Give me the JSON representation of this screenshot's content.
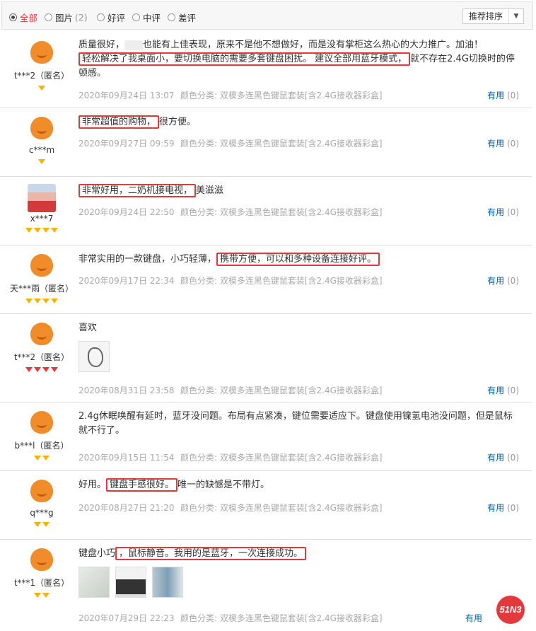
{
  "filters": [
    {
      "label": "全部",
      "checked": true
    },
    {
      "label": "图片",
      "count": "(2)",
      "checked": false
    },
    {
      "label": "好评",
      "checked": false
    },
    {
      "label": "中评",
      "checked": false
    },
    {
      "label": "差评",
      "checked": false
    }
  ],
  "sort": {
    "label": "推荐排序"
  },
  "spec_prefix": "颜色分类: ",
  "useful_label": "有用",
  "reviews": [
    {
      "user": "t***2（匿名）",
      "badge_count": 1,
      "badge_color": "#f5b400",
      "text_before": "质量很好，",
      "text_mid": "也能有上佳表现，原来不是他不想做好，而是没有掌柜这么热心的大力推广。加油！",
      "highlight": "轻松解决了我桌面小，要切换电脑的需要多套键盘困扰。 建议全部用蓝牙模式，",
      "text_after": "就不存在2.4G切换时的停顿感。",
      "date": "2020年09月24日 13:07",
      "spec": "双模多连黑色键鼠套装[含2.4G接收器彩盒]",
      "useful": "(0)"
    },
    {
      "user": "c***m",
      "badge_count": 1,
      "highlight": "非常超值的购物，",
      "text_after": "很方便。",
      "date": "2020年09月27日 09:59",
      "spec": "双模多连黑色键鼠套装[含2.4G接收器彩盒]",
      "useful": "(0)"
    },
    {
      "user": "x***7",
      "badge_count": 4,
      "highlight": "非常好用，二奶机接电视，",
      "text_after": "美滋滋",
      "date": "2020年09月24日 22:50",
      "spec": "双模多连黑色键鼠套装[含2.4G接收器彩盒]",
      "useful": "(0)"
    },
    {
      "user": "天***雨（匿名）",
      "badge_count": 4,
      "text_before": "非常实用的一款键盘，小巧轻薄，",
      "highlight": "携带方便，可以和多种设备连接好评。",
      "date": "2020年09月17日 22:34",
      "spec": "双模多连黑色键鼠套装[含2.4G接收器彩盒]",
      "useful": "(0)"
    },
    {
      "user": "t***2（匿名）",
      "badge_count": 4,
      "badge_color": "#e4393c",
      "text_before": "喜欢",
      "date": "2020年08月31日 23:58",
      "spec": "双模多连黑色键鼠套装[含2.4G接收器彩盒]",
      "useful": "(0)"
    },
    {
      "user": "b***l（匿名）",
      "badge_count": 2,
      "text_before": "2.4g休眠唤醒有延时，蓝牙没问题。布局有点紧凑，键位需要适应下。键盘使用镍氢电池没问题，但是鼠标就不行了。",
      "date": "2020年09月15日 11:54",
      "spec": "双模多连黑色键鼠套装[含2.4G接收器彩盒]",
      "useful": "(0)"
    },
    {
      "user": "q***g",
      "badge_count": 2,
      "text_before": "好用。",
      "highlight": "键盘手感很好。",
      "text_after": "唯一的缺憾是不带灯。",
      "date": "2020年08月27日 21:20",
      "spec": "双模多连黑色键鼠套装[含2.4G接收器彩盒]",
      "useful": "(0)"
    },
    {
      "user": "t***1（匿名）",
      "badge_count": 2,
      "text_before": "键盘小巧",
      "highlight": "，鼠标静音。我用的是蓝牙，一次连接成功。",
      "date": "2020年07月29日 22:23",
      "spec": "双模多连黑色键鼠套装[含2.4G接收器彩盒]",
      "useful": ""
    }
  ],
  "watermark": "51N3"
}
